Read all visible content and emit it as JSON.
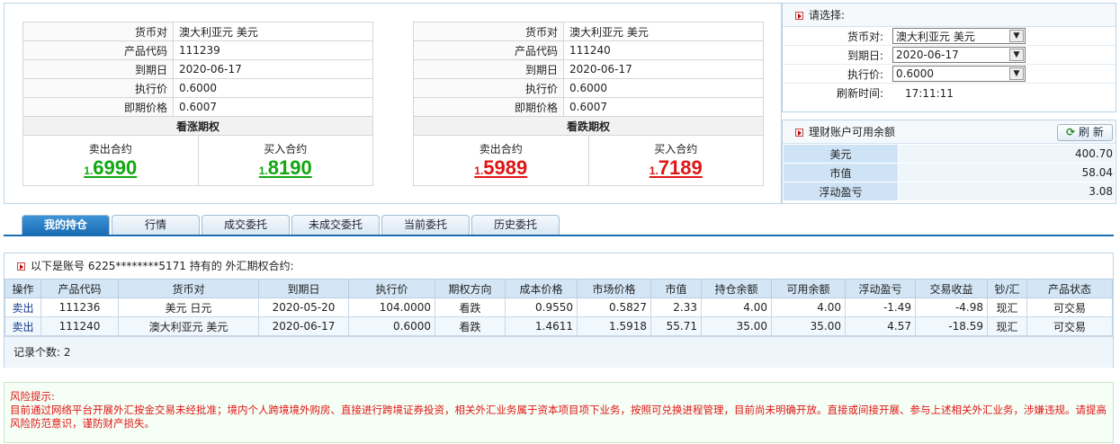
{
  "quote_left": {
    "rows": [
      {
        "label": "货币对",
        "value": "澳大利亚元 美元"
      },
      {
        "label": "产品代码",
        "value": "111239"
      },
      {
        "label": "到期日",
        "value": "2020-06-17"
      },
      {
        "label": "执行价",
        "value": "0.6000"
      },
      {
        "label": "即期价格",
        "value": "0.6007"
      }
    ],
    "option_type": "看涨期权",
    "sell_label": "卖出合约",
    "sell_prefix": "1.",
    "sell_price": "6990",
    "buy_label": "买入合约",
    "buy_prefix": "1.",
    "buy_price": "8190"
  },
  "quote_right": {
    "rows": [
      {
        "label": "货币对",
        "value": "澳大利亚元 美元"
      },
      {
        "label": "产品代码",
        "value": "111240"
      },
      {
        "label": "到期日",
        "value": "2020-06-17"
      },
      {
        "label": "执行价",
        "value": "0.6000"
      },
      {
        "label": "即期价格",
        "value": "0.6007"
      }
    ],
    "option_type": "看跌期权",
    "sell_label": "卖出合约",
    "sell_prefix": "1.",
    "sell_price": "5989",
    "buy_label": "买入合约",
    "buy_prefix": "1.",
    "buy_price": "7189"
  },
  "select_panel": {
    "title": "请选择:",
    "currency_label": "货币对:",
    "currency_value": "澳大利亚元 美元",
    "expiry_label": "到期日:",
    "expiry_value": "2020-06-17",
    "strike_label": "执行价:",
    "strike_value": "0.6000",
    "refresh_time_label": "刷新时间:",
    "refresh_time_value": "17:11:11"
  },
  "balance_panel": {
    "title": "理财账户可用余额",
    "refresh_label": "刷 新",
    "rows": [
      {
        "label": "美元",
        "value": "400.70"
      },
      {
        "label": "市值",
        "value": "58.04"
      },
      {
        "label": "浮动盈亏",
        "value": "3.08"
      }
    ]
  },
  "tabs": [
    "我的持仓",
    "行情",
    "成交委托",
    "未成交委托",
    "当前委托",
    "历史委托"
  ],
  "holdings": {
    "title": "以下是账号 6225********5171 持有的 外汇期权合约:",
    "headers": [
      "操作",
      "产品代码",
      "货币对",
      "到期日",
      "执行价",
      "期权方向",
      "成本价格",
      "市场价格",
      "市值",
      "持仓余额",
      "可用余额",
      "浮动盈亏",
      "交易收益",
      "钞/汇",
      "产品状态"
    ],
    "rows": [
      [
        "卖出",
        "111236",
        "美元 日元",
        "2020-05-20",
        "104.0000",
        "看跌",
        "0.9550",
        "0.5827",
        "2.33",
        "4.00",
        "4.00",
        "-1.49",
        "-4.98",
        "现汇",
        "可交易"
      ],
      [
        "卖出",
        "111240",
        "澳大利亚元 美元",
        "2020-06-17",
        "0.6000",
        "看跌",
        "1.4611",
        "1.5918",
        "55.71",
        "35.00",
        "35.00",
        "4.57",
        "-18.59",
        "现汇",
        "可交易"
      ]
    ],
    "record_count_label": "记录个数:",
    "record_count": "2"
  },
  "risk": {
    "title": "风险提示:",
    "text": "目前通过网络平台开展外汇按金交易未经批准；境内个人跨境境外购房、直接进行跨境证券投资，相关外汇业务属于资本项目项下业务，按照可兑换进程管理，目前尚未明确开放。直接或间接开展、参与上述相关外汇业务，涉嫌违规。请提高风险防范意识，谨防财产损失。"
  },
  "colors": {
    "up": "#11a711",
    "down": "#e01515",
    "tab_active": "#1b6db3"
  }
}
